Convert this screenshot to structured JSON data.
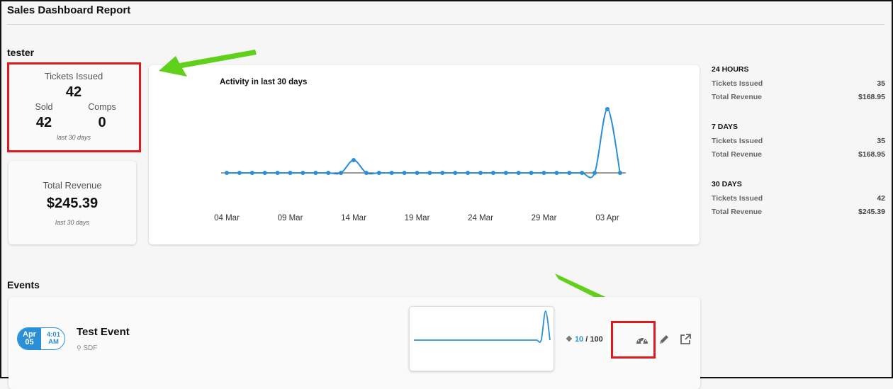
{
  "header": {
    "title": "Sales Dashboard Report"
  },
  "org": {
    "name": "tester"
  },
  "tickets_card": {
    "title": "Tickets Issued",
    "total": "42",
    "sold_label": "Sold",
    "sold_value": "42",
    "comps_label": "Comps",
    "comps_value": "0",
    "period": "last 30 days"
  },
  "revenue_card": {
    "title": "Total Revenue",
    "value": "$245.39",
    "period": "last 30 days"
  },
  "activity_chart": {
    "title": "Activity in last 30 days",
    "x_ticks": [
      "04 Mar",
      "09 Mar",
      "14 Mar",
      "19 Mar",
      "24 Mar",
      "29 Mar",
      "03 Apr"
    ]
  },
  "chart_data": {
    "type": "line",
    "title": "Activity in last 30 days",
    "x": [
      "04 Mar",
      "05 Mar",
      "06 Mar",
      "07 Mar",
      "08 Mar",
      "09 Mar",
      "10 Mar",
      "11 Mar",
      "12 Mar",
      "13 Mar",
      "14 Mar",
      "15 Mar",
      "16 Mar",
      "17 Mar",
      "18 Mar",
      "19 Mar",
      "20 Mar",
      "21 Mar",
      "22 Mar",
      "23 Mar",
      "24 Mar",
      "25 Mar",
      "26 Mar",
      "27 Mar",
      "28 Mar",
      "29 Mar",
      "30 Mar",
      "31 Mar",
      "01 Apr",
      "02 Apr",
      "03 Apr",
      "04 Apr"
    ],
    "values": [
      0,
      0,
      0,
      0,
      0,
      0,
      0,
      0,
      0,
      0,
      1,
      0,
      0,
      0,
      0,
      0,
      0,
      0,
      0,
      0,
      0,
      0,
      0,
      0,
      0,
      0,
      0,
      0,
      0,
      0,
      5,
      0
    ],
    "ylim": [
      0,
      5
    ],
    "grid": false,
    "colors": {
      "line": "#2a8fd6",
      "baseline": "#333333"
    }
  },
  "summary": {
    "groups": [
      {
        "heading": "24 HOURS",
        "rows": [
          {
            "label": "Tickets Issued",
            "value": "35"
          },
          {
            "label": "Total Revenue",
            "value": "$168.95"
          }
        ]
      },
      {
        "heading": "7 DAYS",
        "rows": [
          {
            "label": "Tickets Issued",
            "value": "35"
          },
          {
            "label": "Total Revenue",
            "value": "$168.95"
          }
        ]
      },
      {
        "heading": "30 DAYS",
        "rows": [
          {
            "label": "Tickets Issued",
            "value": "42"
          },
          {
            "label": "Total Revenue",
            "value": "$245.39"
          }
        ]
      }
    ]
  },
  "events": {
    "heading": "Events",
    "items": [
      {
        "month": "Apr",
        "day": "05",
        "time": "4:01",
        "ampm": "AM",
        "name": "Test Event",
        "location": "SDF",
        "sold": "10",
        "capacity": "/ 100",
        "mini_chart_values": [
          0,
          0,
          0,
          0,
          0,
          0,
          0,
          0,
          0,
          0,
          0,
          0,
          0,
          0,
          0,
          0,
          0,
          0,
          0,
          0,
          0,
          0,
          0,
          0,
          0,
          0,
          0,
          0,
          0,
          0,
          5,
          0
        ],
        "icons": [
          "dashboard-icon",
          "pencil-icon",
          "external-link-icon"
        ]
      }
    ]
  },
  "colors": {
    "accent": "#2a8fd6",
    "highlight": "#e0191e",
    "arrow": "#5fd11a"
  }
}
